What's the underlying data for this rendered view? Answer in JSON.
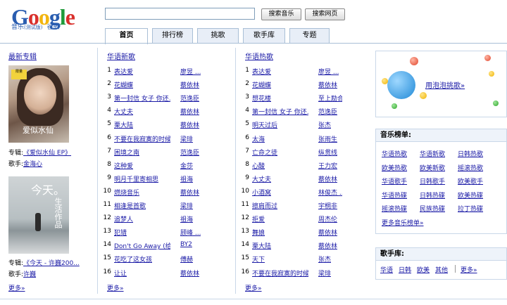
{
  "header": {
    "logo_text": "Google",
    "logo_sub_prefix": "音乐",
    "logo_sub_beta": "测试版",
    "logo_sub_suffix": "谷歌",
    "search_value": "",
    "btn_music": "搜索音乐",
    "btn_web": "搜索网页",
    "logo_colors": [
      "#2a5db0",
      "#d9302c",
      "#f2b50f",
      "#2a5db0",
      "#1f9b3a",
      "#d9302c"
    ]
  },
  "tabs": [
    {
      "label": "首页",
      "active": true
    },
    {
      "label": "排行榜",
      "active": false
    },
    {
      "label": "挑歌",
      "active": false
    },
    {
      "label": "歌手库",
      "active": false
    },
    {
      "label": "专题",
      "active": false
    }
  ],
  "albums": {
    "title": "最新专辑",
    "a1_label": "专辑:",
    "a1_album": "《爱似水仙 EP》",
    "a1_singer_label": "歌手:",
    "a1_singer": "金海心",
    "a2_label": "专辑:",
    "a2_album": "《今天 - 许巍200...",
    "a2_singer_label": "歌手:",
    "a2_singer": "许巍",
    "more": "更多»",
    "cover1_tag": "限量",
    "cover1_title": "爱似水仙",
    "cover2_title": "今天。",
    "cover2_sub": "生活作品"
  },
  "new_songs": {
    "title": "华语新歌",
    "more": "更多»",
    "rows": [
      {
        "n": "1",
        "t": "表达爱",
        "a": "廖昱 ..."
      },
      {
        "n": "2",
        "t": "花蝴蝶",
        "a": "蔡依林"
      },
      {
        "n": "3",
        "t": "第一封信 女子 你还...",
        "a": "范逸臣"
      },
      {
        "n": "4",
        "t": "大丈夫",
        "a": "蔡依林"
      },
      {
        "n": "5",
        "t": "栗大陆",
        "a": "蔡依林"
      },
      {
        "n": "6",
        "t": "不要在我寂寞的时候...",
        "a": "梁琲"
      },
      {
        "n": "7",
        "t": "困境之南",
        "a": "范逸臣"
      },
      {
        "n": "8",
        "t": "这种爱",
        "a": "金莎"
      },
      {
        "n": "9",
        "t": "明月千里寄相思",
        "a": "祖海"
      },
      {
        "n": "10",
        "t": "燃烧音乐",
        "a": "蔡依林"
      },
      {
        "n": "11",
        "t": "相逢是首歌",
        "a": "梁琲"
      },
      {
        "n": "12",
        "t": "追梦人",
        "a": "祖海"
      },
      {
        "n": "13",
        "t": "犯错",
        "a": "顾峰 ..."
      },
      {
        "n": "14",
        "t": "Don't Go Away (给...",
        "a": "BY2"
      },
      {
        "n": "15",
        "t": "花吃了这女孩",
        "a": "傅赫"
      },
      {
        "n": "16",
        "t": "让让",
        "a": "蔡依林"
      }
    ]
  },
  "hot_songs": {
    "title": "华语热歌",
    "more": "更多»",
    "rows": [
      {
        "n": "1",
        "t": "表达爱",
        "a": "廖昱 ..."
      },
      {
        "n": "2",
        "t": "花蝴蝶",
        "a": "蔡依林"
      },
      {
        "n": "3",
        "t": "想花楼",
        "a": "至上励合"
      },
      {
        "n": "4",
        "t": "第一封信 女子 你还...",
        "a": "范逸臣"
      },
      {
        "n": "5",
        "t": "明天过后",
        "a": "张杰"
      },
      {
        "n": "6",
        "t": "太海",
        "a": "张雨生"
      },
      {
        "n": "7",
        "t": "亡命之徒",
        "a": "纵贯线"
      },
      {
        "n": "8",
        "t": "心酸",
        "a": "王力宏"
      },
      {
        "n": "9",
        "t": "大丈夫",
        "a": "蔡依林"
      },
      {
        "n": "10",
        "t": "小酒窝",
        "a": "林俊杰 ..."
      },
      {
        "n": "11",
        "t": "擦肩而过",
        "a": "宇桐非"
      },
      {
        "n": "12",
        "t": "拒爱",
        "a": "周杰伦"
      },
      {
        "n": "13",
        "t": "舞娘",
        "a": "蔡依林"
      },
      {
        "n": "14",
        "t": "栗大陆",
        "a": "蔡依林"
      },
      {
        "n": "15",
        "t": "天下",
        "a": "张杰"
      },
      {
        "n": "16",
        "t": "不要在我寂寞的时候...",
        "a": "梁琲"
      }
    ]
  },
  "bubble": {
    "link": "用泡泡挑歌»"
  },
  "charts": {
    "title": "音乐榜单:",
    "items": [
      "华语热歌",
      "华语新歌",
      "日韩热歌",
      "欧美热歌",
      "欧美新歌",
      "摇滚热歌",
      "华语歌手",
      "日韩歌手",
      "欧美歌手",
      "华语热碟",
      "日韩热碟",
      "欧美热碟",
      "摇滚热碟",
      "民族热碟",
      "拉丁热碟"
    ],
    "more": "更多音乐榜单»"
  },
  "singers": {
    "title": "歌手库:",
    "items": [
      "华语",
      "日韩",
      "欧美",
      "其他"
    ],
    "more": "更多»"
  }
}
